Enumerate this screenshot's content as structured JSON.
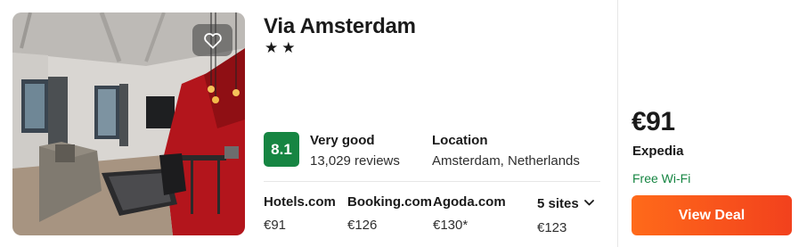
{
  "hotel": {
    "name": "Via Amsterdam",
    "stars": "★★",
    "score": "8.1",
    "rating_word": "Very good",
    "reviews": "13,029 reviews",
    "location_label": "Location",
    "location": "Amsterdam, Netherlands"
  },
  "sites": [
    {
      "name": "Hotels.com",
      "price": "€91"
    },
    {
      "name": "Booking.com",
      "price": "€126"
    },
    {
      "name": "Agoda.com",
      "price": "€130*"
    }
  ],
  "more_sites": {
    "label": "5 sites",
    "price": "€123",
    "icon": "chevron-down-icon"
  },
  "deal": {
    "price": "€91",
    "provider": "Expedia",
    "amenity": "Free Wi-Fi",
    "button_label": "View Deal"
  },
  "icons": {
    "favorite": "heart-outline-icon"
  },
  "colors": {
    "score_badge": "#168542",
    "amenity_text": "#168542",
    "button_start": "#ff6a1a",
    "button_end": "#f2411d"
  }
}
